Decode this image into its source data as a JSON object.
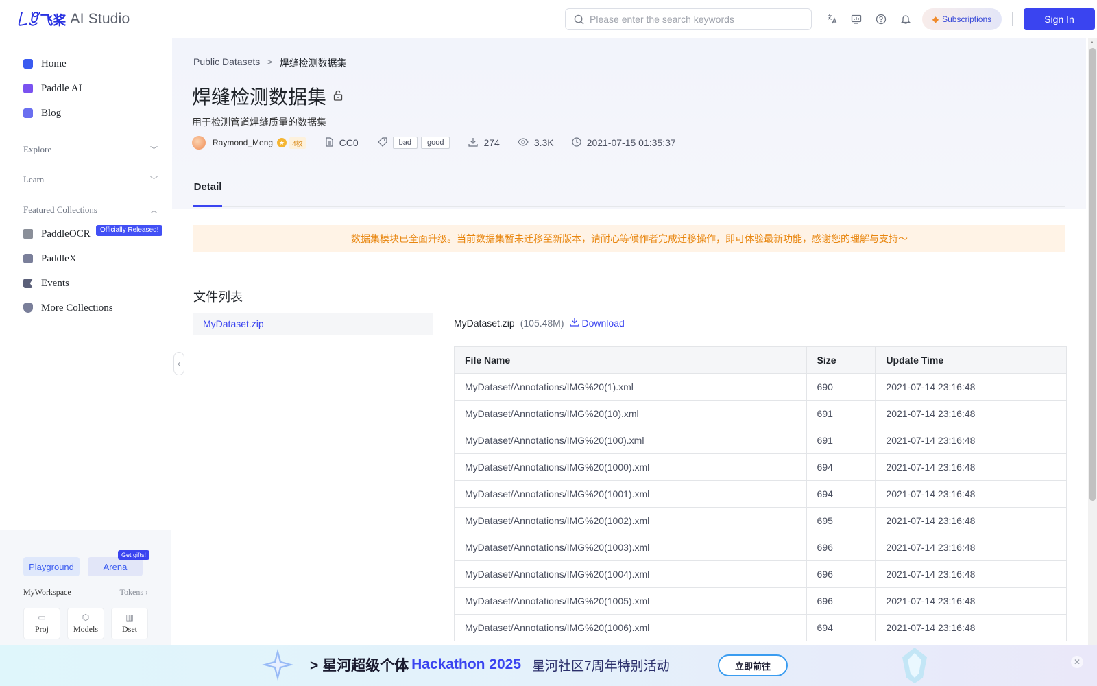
{
  "header": {
    "logo_mark": "꒒ꆚ",
    "logo_cn": "飞桨",
    "logo_en": "AI Studio",
    "search_placeholder": "Please enter the search keywords",
    "subscriptions_label": "Subscriptions",
    "signin_label": "Sign In"
  },
  "sidebar": {
    "items": [
      {
        "label": "Home",
        "color": "#3a5bf0"
      },
      {
        "label": "Paddle AI",
        "color": "#7a52f0"
      },
      {
        "label": "Blog",
        "color": "#6a6ff0"
      }
    ],
    "sections": [
      {
        "label": "Explore",
        "chev": "﹀"
      },
      {
        "label": "Learn",
        "chev": "﹀"
      },
      {
        "label": "Featured Collections",
        "chev": "︿"
      }
    ],
    "collections": [
      {
        "label": "PaddleOCR"
      },
      {
        "label": "PaddleX"
      },
      {
        "label": "Events"
      },
      {
        "label": "More Collections"
      }
    ],
    "released_badge": "Officially Released!",
    "playground_label": "Playground",
    "arena_label": "Arena",
    "gift_badge": "Get gifts!",
    "workspace_label": "MyWorkspace",
    "tokens_label": "Tokens",
    "tiles": [
      {
        "label": "Proj",
        "icon": "▭"
      },
      {
        "label": "Models",
        "icon": "⬡"
      },
      {
        "label": "Dset",
        "icon": "▥"
      }
    ]
  },
  "dataset": {
    "breadcrumb": [
      "Public Datasets",
      "焊缝检测数据集"
    ],
    "breadcrumb_sep": ">",
    "title": "焊缝检测数据集",
    "subtitle": "用于检测管道焊缝质量的数据集",
    "author": "Raymond_Meng",
    "achievement": "4枚",
    "license": "CC0",
    "tags": [
      "bad",
      "good"
    ],
    "downloads": "274",
    "views": "3.3K",
    "updated": "2021-07-15 01:35:37"
  },
  "tabs": [
    {
      "label": "Detail",
      "active": true
    }
  ],
  "notice": "数据集模块已全面升级。当前数据集暂未迁移至新版本，请耐心等候作者完成迁移操作，即可体验最新功能，感谢您的理解与支持～",
  "file_list": {
    "title": "文件列表",
    "files": [
      "MyDataset.zip"
    ],
    "selected_name": "MyDataset.zip",
    "selected_size": "(105.48M)",
    "download_label": "Download",
    "columns": [
      "File Name",
      "Size",
      "Update Time"
    ],
    "rows": [
      [
        "MyDataset/Annotations/IMG%20(1).xml",
        "690",
        "2021-07-14 23:16:48"
      ],
      [
        "MyDataset/Annotations/IMG%20(10).xml",
        "691",
        "2021-07-14 23:16:48"
      ],
      [
        "MyDataset/Annotations/IMG%20(100).xml",
        "691",
        "2021-07-14 23:16:48"
      ],
      [
        "MyDataset/Annotations/IMG%20(1000).xml",
        "694",
        "2021-07-14 23:16:48"
      ],
      [
        "MyDataset/Annotations/IMG%20(1001).xml",
        "694",
        "2021-07-14 23:16:48"
      ],
      [
        "MyDataset/Annotations/IMG%20(1002).xml",
        "695",
        "2021-07-14 23:16:48"
      ],
      [
        "MyDataset/Annotations/IMG%20(1003).xml",
        "696",
        "2021-07-14 23:16:48"
      ],
      [
        "MyDataset/Annotations/IMG%20(1004).xml",
        "696",
        "2021-07-14 23:16:48"
      ],
      [
        "MyDataset/Annotations/IMG%20(1005).xml",
        "696",
        "2021-07-14 23:16:48"
      ],
      [
        "MyDataset/Annotations/IMG%20(1006).xml",
        "694",
        "2021-07-14 23:16:48"
      ]
    ]
  },
  "banner": {
    "prefix": "> 星河超级个体",
    "hackathon": "Hackathon 2025",
    "sub": "星河社区7周年特别活动",
    "button_label": "立即前往"
  }
}
